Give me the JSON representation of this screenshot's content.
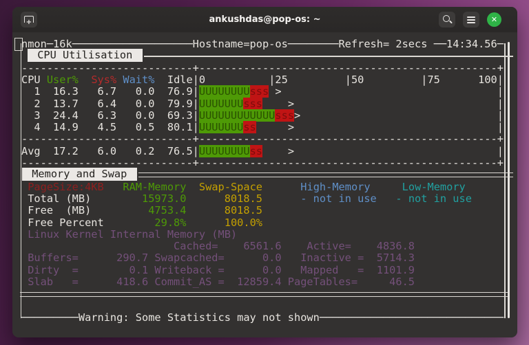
{
  "window": {
    "title": "ankushdas@pop-os: ~"
  },
  "titlebar": {
    "new_tab_icon": "tab-with-plus",
    "search_icon": "magnifier",
    "menu_icon": "hamburger",
    "close_icon": "x-in-green-circle"
  },
  "palette": {
    "white": "#E7E4DF",
    "green": "#4E9A06",
    "red": "#B42B2B",
    "dark_red": "#8F1F1F",
    "blue": "#5F8FC7",
    "cyan": "#21A0A0",
    "yellow": "#C4A000",
    "magenta": "#74507A",
    "bar_green_bg": "#4E9A06",
    "bar_green_fg": "#2A5200",
    "bar_red_bg": "#C01414",
    "bar_red_fg": "#7E0C0C",
    "border": "#DCD9D4",
    "scrollbar": "#E8E5E1",
    "label_bg": "#EBE8E5",
    "label_fg": "#24221F",
    "close_green": "#2FB347"
  },
  "sections": {
    "cpu_label": " CPU Utilisation ",
    "mem_label": " Memory and Swap "
  },
  "terminal": {
    "rows": [
      {
        "name": "nmon-top-border",
        "row": 0,
        "type": "text",
        "segs": [
          [
            "w",
            "nmon─16k───────────────────Hostname=pop-os────────Refresh= 2secs ──14:34.56─"
          ]
        ]
      },
      {
        "name": "cpu-section-header",
        "row": 1,
        "type": "label",
        "label": " CPU Utilisation ",
        "line": "single",
        "indent": 9
      },
      {
        "name": "dashed-separator-top",
        "row": 2,
        "type": "text",
        "segs": [
          [
            "w",
            "---------------------------+-----------------------------------------------+"
          ]
        ]
      },
      {
        "name": "cpu-table-header",
        "row": 3,
        "type": "text",
        "segs": [
          [
            "w",
            "CPU "
          ],
          [
            "g",
            "User%"
          ],
          [
            "w",
            "  "
          ],
          [
            "r",
            "Sys%"
          ],
          [
            "w",
            " "
          ],
          [
            "b",
            "Wait%"
          ],
          [
            "w",
            "  Idle|0          |25         |50         |75      100|"
          ]
        ]
      },
      {
        "name": "cpu1-row",
        "row": 4,
        "type": "text",
        "segs": [
          [
            "w",
            "  1  16.3   6.7   0.0  76.9|"
          ],
          [
            "U",
            "UUUUUUUU"
          ],
          [
            "S",
            "sss"
          ],
          [
            "w",
            " >                                  |"
          ]
        ]
      },
      {
        "name": "cpu2-row",
        "row": 5,
        "type": "text",
        "segs": [
          [
            "w",
            "  2  13.7   6.4   0.0  79.9|"
          ],
          [
            "U",
            "UUUUUUU"
          ],
          [
            "S",
            "sss"
          ],
          [
            "w",
            "    >                                |"
          ]
        ]
      },
      {
        "name": "cpu3-row",
        "row": 6,
        "type": "text",
        "segs": [
          [
            "w",
            "  3  24.4   6.3   0.0  69.3|"
          ],
          [
            "U",
            "UUUUUUUUUUUU"
          ],
          [
            "S",
            "sss"
          ],
          [
            "w",
            ">                               |"
          ]
        ]
      },
      {
        "name": "cpu4-row",
        "row": 7,
        "type": "text",
        "segs": [
          [
            "w",
            "  4  14.9   4.5   0.5  80.1|"
          ],
          [
            "U",
            "UUUUUUU"
          ],
          [
            "S",
            "ss"
          ],
          [
            "w",
            "     >                                |"
          ]
        ]
      },
      {
        "name": "dashed-separator-mid1",
        "row": 8,
        "type": "text",
        "segs": [
          [
            "w",
            "---------------------------+-----------------------------------------------+"
          ]
        ]
      },
      {
        "name": "cpu-avg-row",
        "row": 9,
        "type": "text",
        "segs": [
          [
            "w",
            "Avg  17.2   6.0   0.2  76.5|"
          ],
          [
            "U",
            "UUUUUUUU"
          ],
          [
            "S",
            "ss"
          ],
          [
            "w",
            "    >                                |"
          ]
        ]
      },
      {
        "name": "dashed-separator-mid2",
        "row": 10,
        "type": "text",
        "segs": [
          [
            "w",
            "---------------------------+-----------------------------------------------+"
          ]
        ]
      },
      {
        "name": "mem-section-header",
        "row": 11,
        "type": "label",
        "label": " Memory and Swap ",
        "line": "double",
        "indent": 1
      },
      {
        "name": "mem-column-header",
        "row": 12,
        "type": "text",
        "segs": [
          [
            "dr",
            " PageSize:4KB"
          ],
          [
            "w",
            "   "
          ],
          [
            "g",
            "RAM-Memory"
          ],
          [
            "w",
            "  "
          ],
          [
            "y",
            "Swap-Space"
          ],
          [
            "w",
            "      "
          ],
          [
            "b",
            "High-Memory"
          ],
          [
            "w",
            "     "
          ],
          [
            "c",
            "Low-Memory"
          ]
        ]
      },
      {
        "name": "mem-total-row",
        "row": 13,
        "type": "text",
        "segs": [
          [
            "w",
            " Total (MB)        "
          ],
          [
            "g",
            "15973.0"
          ],
          [
            "w",
            "      "
          ],
          [
            "y",
            "8018.5"
          ],
          [
            "w",
            "      "
          ],
          [
            "b",
            "- not in use"
          ],
          [
            "w",
            "   "
          ],
          [
            "c",
            "- not in use"
          ]
        ]
      },
      {
        "name": "mem-free-row",
        "row": 14,
        "type": "text",
        "segs": [
          [
            "w",
            " Free  (MB)         "
          ],
          [
            "g",
            "4753.4"
          ],
          [
            "w",
            "      "
          ],
          [
            "y",
            "8018.5"
          ]
        ]
      },
      {
        "name": "mem-free-percent-row",
        "row": 15,
        "type": "text",
        "segs": [
          [
            "w",
            " Free Percent        "
          ],
          [
            "g",
            "29.8%"
          ],
          [
            "w",
            "      "
          ],
          [
            "y",
            "100.0%"
          ]
        ]
      },
      {
        "name": "kernel-mem-title",
        "row": 16,
        "type": "text",
        "segs": [
          [
            "m",
            " Linux Kernel Internal Memory (MB)"
          ]
        ]
      },
      {
        "name": "kernel-cached-row",
        "row": 17,
        "type": "text",
        "segs": [
          [
            "m",
            "                        Cached=    6561.6    Active=    4836.8"
          ]
        ]
      },
      {
        "name": "kernel-buffers-row",
        "row": 18,
        "type": "text",
        "segs": [
          [
            "m",
            " Buffers=      290.7 Swapcached=      0.0   Inactive =  5714.3"
          ]
        ]
      },
      {
        "name": "kernel-dirty-row",
        "row": 19,
        "type": "text",
        "segs": [
          [
            "m",
            " Dirty  =        0.1 Writeback =      0.0   Mapped   =  1101.9"
          ]
        ]
      },
      {
        "name": "kernel-slab-row",
        "row": 20,
        "type": "text",
        "segs": [
          [
            "m",
            " Slab   =      418.6 Commit_AS =  12859.4 PageTables=     46.5"
          ]
        ]
      },
      {
        "name": "mem-bottom-rule",
        "row": 21,
        "type": "hline2"
      },
      {
        "name": "nmon-bottom-border",
        "row": 23,
        "type": "text",
        "segs": [
          [
            "w",
            "─────────Warning: Some Statistics may not shown─────────────────────────────"
          ]
        ]
      }
    ]
  }
}
